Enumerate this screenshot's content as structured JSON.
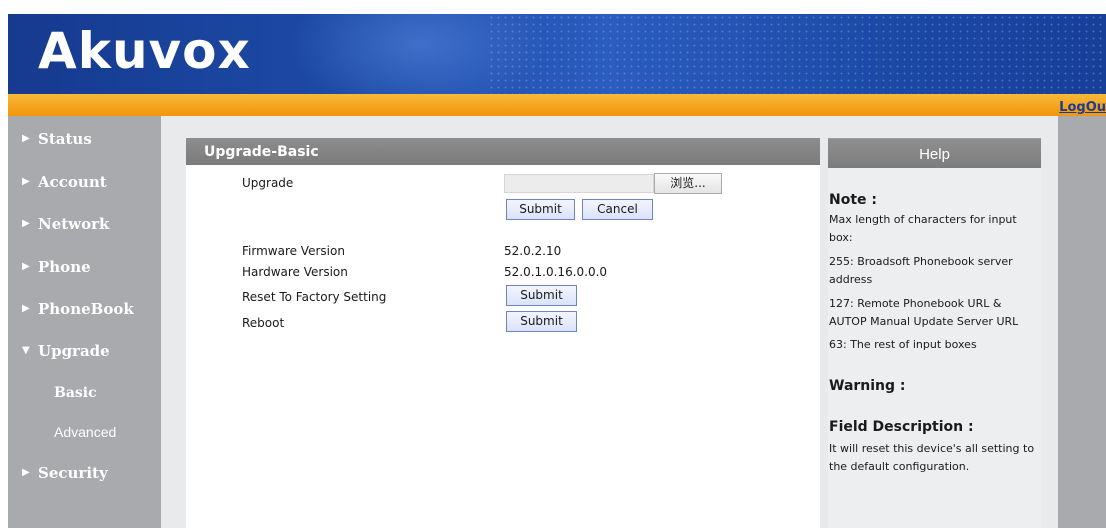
{
  "brand": {
    "logo_text": "Akuvox",
    "logout_label": "LogOu"
  },
  "sidebar": {
    "items": [
      {
        "label": "Status",
        "expanded": false
      },
      {
        "label": "Account",
        "expanded": false
      },
      {
        "label": "Network",
        "expanded": false
      },
      {
        "label": "Phone",
        "expanded": false
      },
      {
        "label": "PhoneBook",
        "expanded": false
      },
      {
        "label": "Upgrade",
        "expanded": true
      },
      {
        "label": "Security",
        "expanded": false
      }
    ],
    "upgrade_subitems": [
      {
        "label": "Basic",
        "active": true
      },
      {
        "label": "Advanced",
        "active": false
      }
    ],
    "arrow_collapsed": "▶",
    "arrow_expanded": "▼"
  },
  "main": {
    "section_title": "Upgrade-Basic",
    "upgrade_label": "Upgrade",
    "file_value": "",
    "browse_label": "浏览...",
    "submit_label": "Submit",
    "cancel_label": "Cancel",
    "firmware_label": "Firmware Version",
    "firmware_value": "52.0.2.10",
    "hardware_label": "Hardware Version",
    "hardware_value": "52.0.1.0.16.0.0.0",
    "reset_label": "Reset To Factory Setting",
    "reset_button": "Submit",
    "reboot_label": "Reboot",
    "reboot_button": "Submit"
  },
  "help": {
    "title": "Help",
    "note_heading": "Note :",
    "note_lines": [
      "Max length of characters for input box:",
      "255: Broadsoft Phonebook server address",
      "127: Remote Phonebook URL & AUTOP Manual Update Server URL",
      "63: The rest of input boxes"
    ],
    "warning_heading": "Warning :",
    "field_heading": "Field Description :",
    "field_text": "It will reset this device's all setting to the default configuration."
  },
  "colors": {
    "header_blue": "#1d4aa6",
    "orange_bar": "#f4a31c",
    "sidebar_gray": "#a8aaad",
    "section_header_gray": "#7b7b7b",
    "link_blue": "#1b3b9a"
  }
}
